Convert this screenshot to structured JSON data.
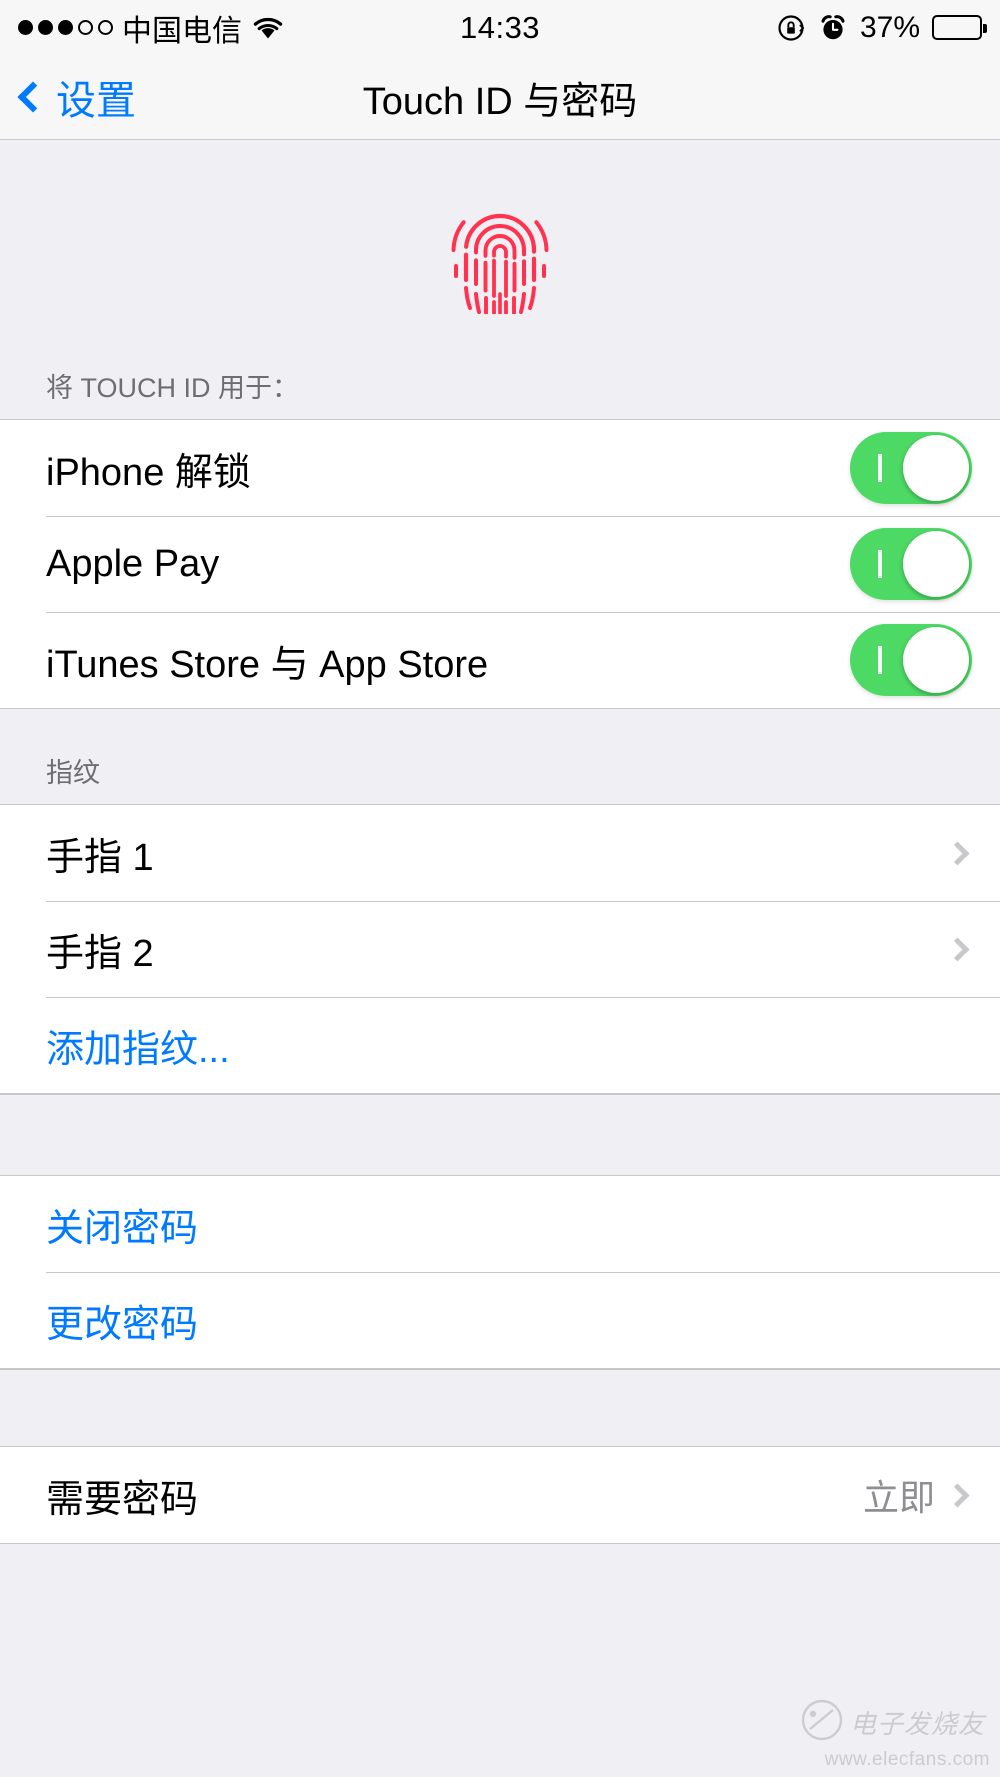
{
  "status_bar": {
    "signal_dots_filled": 3,
    "signal_dots_total": 5,
    "carrier": "中国电信",
    "wifi_icon": "wifi-icon",
    "time": "14:33",
    "rotation_lock_icon": "rotation-lock-icon",
    "alarm_icon": "alarm-clock-icon",
    "battery_percent": "37%",
    "battery_level": 37
  },
  "nav": {
    "back_label": "设置",
    "title": "Touch ID 与密码"
  },
  "hero": {
    "icon": "fingerprint-icon",
    "icon_color": "#ff3250"
  },
  "sections": [
    {
      "header": "将 TOUCH ID 用于：",
      "rows": [
        {
          "label": "iPhone 解锁",
          "control": "toggle",
          "on": true
        },
        {
          "label": "Apple Pay",
          "control": "toggle",
          "on": true
        },
        {
          "label": "iTunes Store 与 App Store",
          "control": "toggle",
          "on": true
        }
      ]
    },
    {
      "header": "指纹",
      "rows": [
        {
          "label": "手指 1",
          "control": "chevron"
        },
        {
          "label": "手指 2",
          "control": "chevron"
        },
        {
          "label": "添加指纹...",
          "control": "none",
          "style": "blue"
        }
      ]
    },
    {
      "header": "",
      "rows": [
        {
          "label": "关闭密码",
          "control": "none",
          "style": "blue"
        },
        {
          "label": "更改密码",
          "control": "none",
          "style": "blue"
        }
      ]
    },
    {
      "header": "",
      "rows": [
        {
          "label": "需要密码",
          "control": "chevron",
          "value": "立即"
        }
      ]
    }
  ],
  "watermark": {
    "mark": "电子发烧友",
    "url": "www.elecfans.com"
  },
  "colors": {
    "accent_blue": "#007aff",
    "toggle_green": "#4cd964",
    "group_bg": "#ffffff",
    "page_bg": "#efeff4",
    "separator": "#c8c7cc",
    "secondary_text": "#8e8e93"
  }
}
